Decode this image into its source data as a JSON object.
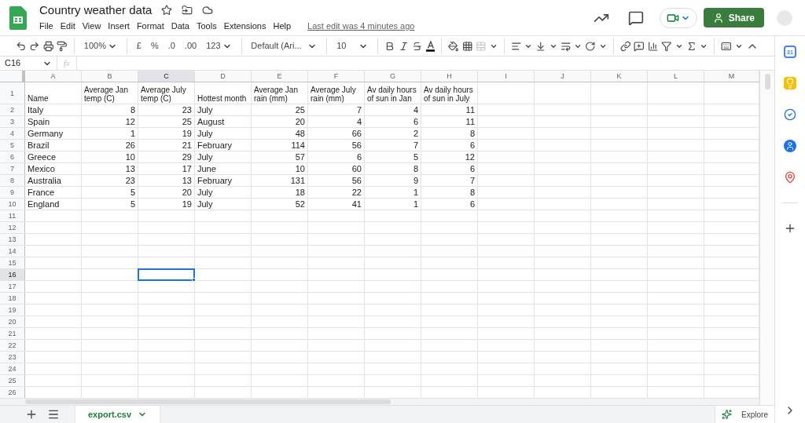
{
  "document": {
    "title": "Country weather data",
    "last_edit": "Last edit was 4 minutes ago"
  },
  "menu": [
    "File",
    "Edit",
    "View",
    "Insert",
    "Format",
    "Data",
    "Tools",
    "Extensions",
    "Help"
  ],
  "share_button": "Share",
  "toolbar": {
    "zoom": "100%",
    "currency": "£",
    "percent": "%",
    "decimal_decrease": ".0",
    "decimal_increase": ".00",
    "number_format": "123",
    "font": "Default (Ari...",
    "font_size": "10"
  },
  "formula_bar": {
    "cell_ref": "C16",
    "fx": "fx"
  },
  "columns": [
    {
      "label": "A",
      "kind": "text",
      "selected": false
    },
    {
      "label": "B",
      "kind": "number",
      "selected": false
    },
    {
      "label": "C",
      "kind": "number",
      "selected": true
    },
    {
      "label": "D",
      "kind": "text",
      "selected": false
    },
    {
      "label": "E",
      "kind": "number",
      "selected": false
    },
    {
      "label": "F",
      "kind": "number",
      "selected": false
    },
    {
      "label": "G",
      "kind": "number",
      "selected": false
    },
    {
      "label": "H",
      "kind": "number",
      "selected": false
    },
    {
      "label": "I",
      "kind": "text",
      "selected": false
    },
    {
      "label": "J",
      "kind": "text",
      "selected": false
    },
    {
      "label": "K",
      "kind": "text",
      "selected": false
    },
    {
      "label": "L",
      "kind": "text",
      "selected": false
    },
    {
      "label": "M",
      "kind": "text",
      "selected": false
    }
  ],
  "header_row": {
    "number": "1",
    "cells": [
      "Name",
      "Average Jan temp (C)",
      "Average July temp (C)",
      "Hottest month",
      "Average Jan rain (mm)",
      "Average July rain (mm)",
      "Av daily hours of sun in Jan",
      "Av daily hours of sun in July"
    ]
  },
  "rows": [
    {
      "number": "2",
      "selected": false,
      "cells": [
        "Italy",
        "8",
        "23",
        "July",
        "25",
        "7",
        "4",
        "11"
      ]
    },
    {
      "number": "3",
      "selected": false,
      "cells": [
        "Spain",
        "12",
        "25",
        "August",
        "20",
        "4",
        "6",
        "11"
      ]
    },
    {
      "number": "4",
      "selected": false,
      "cells": [
        "Germany",
        "1",
        "19",
        "July",
        "48",
        "66",
        "2",
        "8"
      ]
    },
    {
      "number": "5",
      "selected": false,
      "cells": [
        "Brazil",
        "26",
        "21",
        "February",
        "114",
        "56",
        "7",
        "6"
      ]
    },
    {
      "number": "6",
      "selected": false,
      "cells": [
        "Greece",
        "10",
        "29",
        "July",
        "57",
        "6",
        "5",
        "12"
      ]
    },
    {
      "number": "7",
      "selected": false,
      "cells": [
        "Mexico",
        "13",
        "17",
        "June",
        "10",
        "60",
        "8",
        "6"
      ]
    },
    {
      "number": "8",
      "selected": false,
      "cells": [
        "Australia",
        "23",
        "13",
        "February",
        "131",
        "56",
        "9",
        "7"
      ]
    },
    {
      "number": "9",
      "selected": false,
      "cells": [
        "France",
        "5",
        "20",
        "July",
        "18",
        "22",
        "1",
        "8"
      ]
    },
    {
      "number": "10",
      "selected": false,
      "cells": [
        "England",
        "5",
        "19",
        "July",
        "52",
        "41",
        "1",
        "6"
      ]
    },
    {
      "number": "11",
      "selected": false
    },
    {
      "number": "12",
      "selected": false
    },
    {
      "number": "13",
      "selected": false
    },
    {
      "number": "14",
      "selected": false
    },
    {
      "number": "15",
      "selected": false
    },
    {
      "number": "16",
      "selected": true
    },
    {
      "number": "17",
      "selected": false
    },
    {
      "number": "18",
      "selected": false
    },
    {
      "number": "19",
      "selected": false
    },
    {
      "number": "20",
      "selected": false
    },
    {
      "number": "21",
      "selected": false
    },
    {
      "number": "22",
      "selected": false
    },
    {
      "number": "23",
      "selected": false
    },
    {
      "number": "24",
      "selected": false
    },
    {
      "number": "25",
      "selected": false
    },
    {
      "number": "26",
      "selected": false
    }
  ],
  "sheet_tabs": [
    {
      "label": "export.csv",
      "selected": true
    }
  ],
  "explore_button": "Explore",
  "side_panel": {
    "calendar_day": "31"
  }
}
